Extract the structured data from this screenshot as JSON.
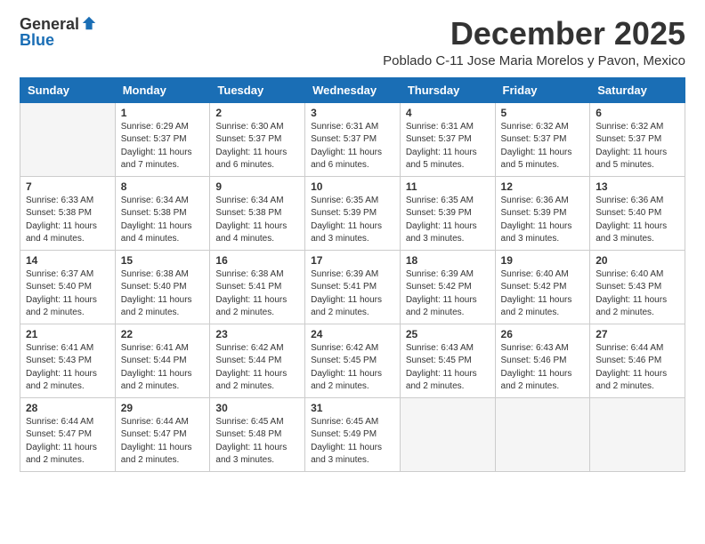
{
  "logo": {
    "general": "General",
    "blue": "Blue",
    "line2": "Blue"
  },
  "header": {
    "title": "December 2025",
    "subtitle": "Poblado C-11 Jose Maria Morelos y Pavon, Mexico"
  },
  "weekdays": [
    "Sunday",
    "Monday",
    "Tuesday",
    "Wednesday",
    "Thursday",
    "Friday",
    "Saturday"
  ],
  "weeks": [
    [
      {
        "num": "",
        "info": ""
      },
      {
        "num": "1",
        "info": "Sunrise: 6:29 AM\nSunset: 5:37 PM\nDaylight: 11 hours\nand 7 minutes."
      },
      {
        "num": "2",
        "info": "Sunrise: 6:30 AM\nSunset: 5:37 PM\nDaylight: 11 hours\nand 6 minutes."
      },
      {
        "num": "3",
        "info": "Sunrise: 6:31 AM\nSunset: 5:37 PM\nDaylight: 11 hours\nand 6 minutes."
      },
      {
        "num": "4",
        "info": "Sunrise: 6:31 AM\nSunset: 5:37 PM\nDaylight: 11 hours\nand 5 minutes."
      },
      {
        "num": "5",
        "info": "Sunrise: 6:32 AM\nSunset: 5:37 PM\nDaylight: 11 hours\nand 5 minutes."
      },
      {
        "num": "6",
        "info": "Sunrise: 6:32 AM\nSunset: 5:37 PM\nDaylight: 11 hours\nand 5 minutes."
      }
    ],
    [
      {
        "num": "7",
        "info": "Sunrise: 6:33 AM\nSunset: 5:38 PM\nDaylight: 11 hours\nand 4 minutes."
      },
      {
        "num": "8",
        "info": "Sunrise: 6:34 AM\nSunset: 5:38 PM\nDaylight: 11 hours\nand 4 minutes."
      },
      {
        "num": "9",
        "info": "Sunrise: 6:34 AM\nSunset: 5:38 PM\nDaylight: 11 hours\nand 4 minutes."
      },
      {
        "num": "10",
        "info": "Sunrise: 6:35 AM\nSunset: 5:39 PM\nDaylight: 11 hours\nand 3 minutes."
      },
      {
        "num": "11",
        "info": "Sunrise: 6:35 AM\nSunset: 5:39 PM\nDaylight: 11 hours\nand 3 minutes."
      },
      {
        "num": "12",
        "info": "Sunrise: 6:36 AM\nSunset: 5:39 PM\nDaylight: 11 hours\nand 3 minutes."
      },
      {
        "num": "13",
        "info": "Sunrise: 6:36 AM\nSunset: 5:40 PM\nDaylight: 11 hours\nand 3 minutes."
      }
    ],
    [
      {
        "num": "14",
        "info": "Sunrise: 6:37 AM\nSunset: 5:40 PM\nDaylight: 11 hours\nand 2 minutes."
      },
      {
        "num": "15",
        "info": "Sunrise: 6:38 AM\nSunset: 5:40 PM\nDaylight: 11 hours\nand 2 minutes."
      },
      {
        "num": "16",
        "info": "Sunrise: 6:38 AM\nSunset: 5:41 PM\nDaylight: 11 hours\nand 2 minutes."
      },
      {
        "num": "17",
        "info": "Sunrise: 6:39 AM\nSunset: 5:41 PM\nDaylight: 11 hours\nand 2 minutes."
      },
      {
        "num": "18",
        "info": "Sunrise: 6:39 AM\nSunset: 5:42 PM\nDaylight: 11 hours\nand 2 minutes."
      },
      {
        "num": "19",
        "info": "Sunrise: 6:40 AM\nSunset: 5:42 PM\nDaylight: 11 hours\nand 2 minutes."
      },
      {
        "num": "20",
        "info": "Sunrise: 6:40 AM\nSunset: 5:43 PM\nDaylight: 11 hours\nand 2 minutes."
      }
    ],
    [
      {
        "num": "21",
        "info": "Sunrise: 6:41 AM\nSunset: 5:43 PM\nDaylight: 11 hours\nand 2 minutes."
      },
      {
        "num": "22",
        "info": "Sunrise: 6:41 AM\nSunset: 5:44 PM\nDaylight: 11 hours\nand 2 minutes."
      },
      {
        "num": "23",
        "info": "Sunrise: 6:42 AM\nSunset: 5:44 PM\nDaylight: 11 hours\nand 2 minutes."
      },
      {
        "num": "24",
        "info": "Sunrise: 6:42 AM\nSunset: 5:45 PM\nDaylight: 11 hours\nand 2 minutes."
      },
      {
        "num": "25",
        "info": "Sunrise: 6:43 AM\nSunset: 5:45 PM\nDaylight: 11 hours\nand 2 minutes."
      },
      {
        "num": "26",
        "info": "Sunrise: 6:43 AM\nSunset: 5:46 PM\nDaylight: 11 hours\nand 2 minutes."
      },
      {
        "num": "27",
        "info": "Sunrise: 6:44 AM\nSunset: 5:46 PM\nDaylight: 11 hours\nand 2 minutes."
      }
    ],
    [
      {
        "num": "28",
        "info": "Sunrise: 6:44 AM\nSunset: 5:47 PM\nDaylight: 11 hours\nand 2 minutes."
      },
      {
        "num": "29",
        "info": "Sunrise: 6:44 AM\nSunset: 5:47 PM\nDaylight: 11 hours\nand 2 minutes."
      },
      {
        "num": "30",
        "info": "Sunrise: 6:45 AM\nSunset: 5:48 PM\nDaylight: 11 hours\nand 3 minutes."
      },
      {
        "num": "31",
        "info": "Sunrise: 6:45 AM\nSunset: 5:49 PM\nDaylight: 11 hours\nand 3 minutes."
      },
      {
        "num": "",
        "info": ""
      },
      {
        "num": "",
        "info": ""
      },
      {
        "num": "",
        "info": ""
      }
    ]
  ]
}
